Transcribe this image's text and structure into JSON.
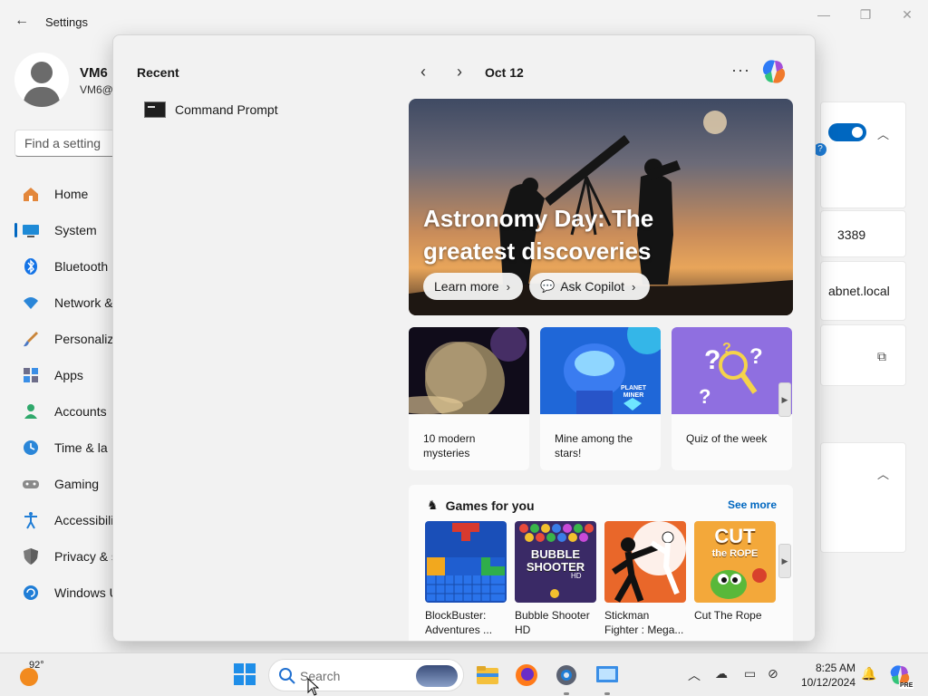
{
  "settings": {
    "title": "Settings",
    "user": {
      "name": "VM6",
      "email": "VM6@"
    },
    "search_placeholder": "Find a setting",
    "nav": [
      {
        "label": "Home",
        "icon": "home-icon"
      },
      {
        "label": "System",
        "icon": "system-icon",
        "active": true
      },
      {
        "label": "Bluetooth",
        "icon": "bluetooth-icon"
      },
      {
        "label": "Network &",
        "icon": "wifi-icon"
      },
      {
        "label": "Personaliz",
        "icon": "brush-icon"
      },
      {
        "label": "Apps",
        "icon": "apps-icon"
      },
      {
        "label": "Accounts",
        "icon": "accounts-icon"
      },
      {
        "label": "Time & la",
        "icon": "clock-icon"
      },
      {
        "label": "Gaming",
        "icon": "gamepad-icon"
      },
      {
        "label": "Accessibili",
        "icon": "accessibility-icon"
      },
      {
        "label": "Privacy & s",
        "icon": "shield-icon"
      },
      {
        "label": "Windows U",
        "icon": "update-icon"
      }
    ],
    "right_panel": {
      "port": "3389",
      "domain": "abnet.local"
    }
  },
  "start_menu": {
    "recent": {
      "title": "Recent",
      "items": [
        {
          "label": "Command Prompt",
          "icon": "command-prompt-icon"
        }
      ]
    },
    "date": "Oct 12",
    "more_label": "···",
    "hero": {
      "title": "Astronomy Day: The greatest discoveries",
      "learn_more": "Learn more",
      "ask_copilot": "Ask Copilot"
    },
    "cards": [
      {
        "caption": "10 modern mysteries"
      },
      {
        "caption": "Mine among the stars!",
        "image_text": "PLANET MINER"
      },
      {
        "caption": "Quiz of the week"
      }
    ],
    "games": {
      "title": "Games for you",
      "see_more": "See more",
      "items": [
        {
          "name": "BlockBuster: Adventures ..."
        },
        {
          "name": "Bubble Shooter HD",
          "tile_text": "BUBBLE SHOOTER",
          "tile_sub": "HD"
        },
        {
          "name": "Stickman Fighter : Mega..."
        },
        {
          "name": "Cut The Rope",
          "tile_text": "CUT",
          "tile_text2": "the ROPE"
        }
      ]
    }
  },
  "taskbar": {
    "weather_temp": "92°",
    "search_placeholder": "Search",
    "time": "8:25 AM",
    "date": "10/12/2024",
    "copilot_badge": "PRE"
  },
  "colors": {
    "accent": "#0067c0",
    "start_bg": "#f2f2f2",
    "taskbar_bg": "#eeeeee"
  }
}
